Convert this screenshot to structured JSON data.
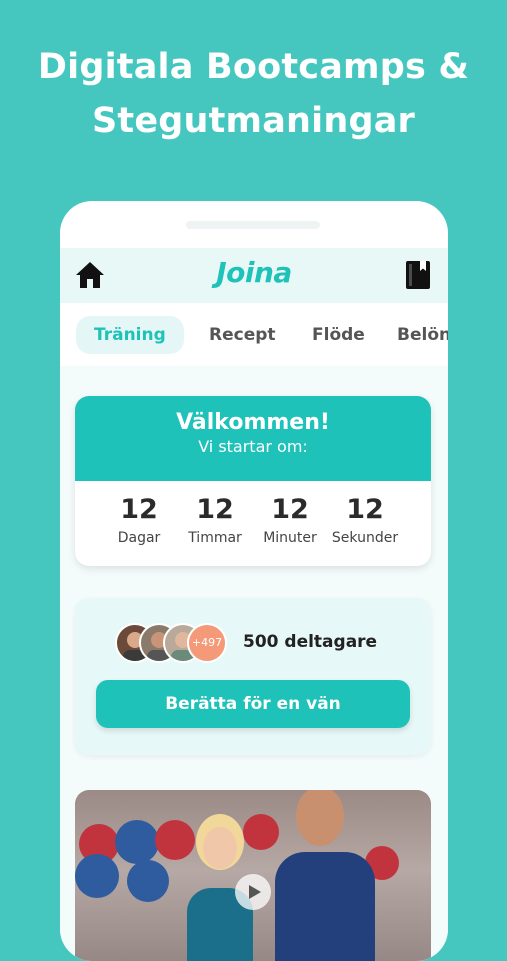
{
  "headline": {
    "line1": "Digitala Bootcamps &",
    "line2": "Stegutmaningar"
  },
  "app": {
    "logo": "Joina",
    "icons": {
      "home": "home-icon",
      "book": "book-icon"
    }
  },
  "tabs": [
    {
      "label": "Träning",
      "active": true
    },
    {
      "label": "Recept",
      "active": false
    },
    {
      "label": "Flöde",
      "active": false
    },
    {
      "label": "Belön",
      "active": false
    }
  ],
  "welcome": {
    "title": "Välkommen!",
    "subtitle": "Vi startar om:",
    "countdown": [
      {
        "value": "12",
        "label": "Dagar"
      },
      {
        "value": "12",
        "label": "Timmar"
      },
      {
        "value": "12",
        "label": "Minuter"
      },
      {
        "value": "12",
        "label": "Sekunder"
      }
    ]
  },
  "participants": {
    "extra_count": "+497",
    "text": "500 deltagare",
    "button": "Berätta för en vän"
  },
  "colors": {
    "background": "#45c7c0",
    "accent": "#1fc2b8",
    "badge": "#f59a79"
  }
}
